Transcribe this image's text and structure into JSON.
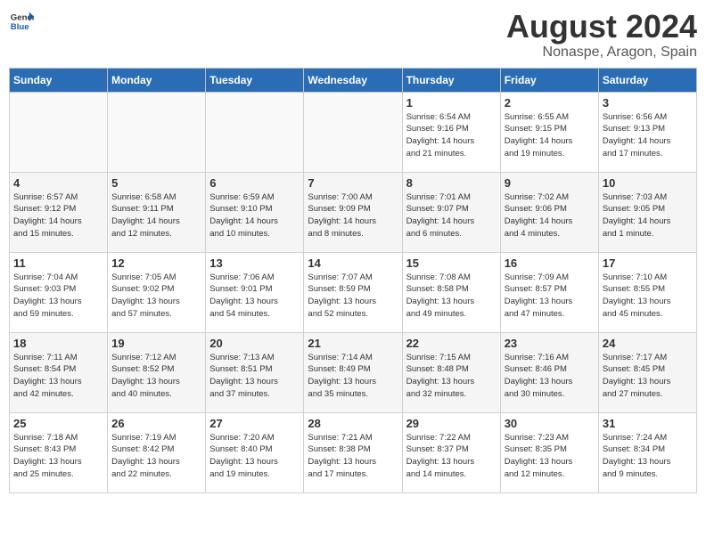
{
  "logo": {
    "general": "General",
    "blue": "Blue"
  },
  "title": {
    "month_year": "August 2024",
    "location": "Nonaspe, Aragon, Spain"
  },
  "weekdays": [
    "Sunday",
    "Monday",
    "Tuesday",
    "Wednesday",
    "Thursday",
    "Friday",
    "Saturday"
  ],
  "weeks": [
    [
      {
        "day": "",
        "info": ""
      },
      {
        "day": "",
        "info": ""
      },
      {
        "day": "",
        "info": ""
      },
      {
        "day": "",
        "info": ""
      },
      {
        "day": "1",
        "info": "Sunrise: 6:54 AM\nSunset: 9:16 PM\nDaylight: 14 hours\nand 21 minutes."
      },
      {
        "day": "2",
        "info": "Sunrise: 6:55 AM\nSunset: 9:15 PM\nDaylight: 14 hours\nand 19 minutes."
      },
      {
        "day": "3",
        "info": "Sunrise: 6:56 AM\nSunset: 9:13 PM\nDaylight: 14 hours\nand 17 minutes."
      }
    ],
    [
      {
        "day": "4",
        "info": "Sunrise: 6:57 AM\nSunset: 9:12 PM\nDaylight: 14 hours\nand 15 minutes."
      },
      {
        "day": "5",
        "info": "Sunrise: 6:58 AM\nSunset: 9:11 PM\nDaylight: 14 hours\nand 12 minutes."
      },
      {
        "day": "6",
        "info": "Sunrise: 6:59 AM\nSunset: 9:10 PM\nDaylight: 14 hours\nand 10 minutes."
      },
      {
        "day": "7",
        "info": "Sunrise: 7:00 AM\nSunset: 9:09 PM\nDaylight: 14 hours\nand 8 minutes."
      },
      {
        "day": "8",
        "info": "Sunrise: 7:01 AM\nSunset: 9:07 PM\nDaylight: 14 hours\nand 6 minutes."
      },
      {
        "day": "9",
        "info": "Sunrise: 7:02 AM\nSunset: 9:06 PM\nDaylight: 14 hours\nand 4 minutes."
      },
      {
        "day": "10",
        "info": "Sunrise: 7:03 AM\nSunset: 9:05 PM\nDaylight: 14 hours\nand 1 minute."
      }
    ],
    [
      {
        "day": "11",
        "info": "Sunrise: 7:04 AM\nSunset: 9:03 PM\nDaylight: 13 hours\nand 59 minutes."
      },
      {
        "day": "12",
        "info": "Sunrise: 7:05 AM\nSunset: 9:02 PM\nDaylight: 13 hours\nand 57 minutes."
      },
      {
        "day": "13",
        "info": "Sunrise: 7:06 AM\nSunset: 9:01 PM\nDaylight: 13 hours\nand 54 minutes."
      },
      {
        "day": "14",
        "info": "Sunrise: 7:07 AM\nSunset: 8:59 PM\nDaylight: 13 hours\nand 52 minutes."
      },
      {
        "day": "15",
        "info": "Sunrise: 7:08 AM\nSunset: 8:58 PM\nDaylight: 13 hours\nand 49 minutes."
      },
      {
        "day": "16",
        "info": "Sunrise: 7:09 AM\nSunset: 8:57 PM\nDaylight: 13 hours\nand 47 minutes."
      },
      {
        "day": "17",
        "info": "Sunrise: 7:10 AM\nSunset: 8:55 PM\nDaylight: 13 hours\nand 45 minutes."
      }
    ],
    [
      {
        "day": "18",
        "info": "Sunrise: 7:11 AM\nSunset: 8:54 PM\nDaylight: 13 hours\nand 42 minutes."
      },
      {
        "day": "19",
        "info": "Sunrise: 7:12 AM\nSunset: 8:52 PM\nDaylight: 13 hours\nand 40 minutes."
      },
      {
        "day": "20",
        "info": "Sunrise: 7:13 AM\nSunset: 8:51 PM\nDaylight: 13 hours\nand 37 minutes."
      },
      {
        "day": "21",
        "info": "Sunrise: 7:14 AM\nSunset: 8:49 PM\nDaylight: 13 hours\nand 35 minutes."
      },
      {
        "day": "22",
        "info": "Sunrise: 7:15 AM\nSunset: 8:48 PM\nDaylight: 13 hours\nand 32 minutes."
      },
      {
        "day": "23",
        "info": "Sunrise: 7:16 AM\nSunset: 8:46 PM\nDaylight: 13 hours\nand 30 minutes."
      },
      {
        "day": "24",
        "info": "Sunrise: 7:17 AM\nSunset: 8:45 PM\nDaylight: 13 hours\nand 27 minutes."
      }
    ],
    [
      {
        "day": "25",
        "info": "Sunrise: 7:18 AM\nSunset: 8:43 PM\nDaylight: 13 hours\nand 25 minutes."
      },
      {
        "day": "26",
        "info": "Sunrise: 7:19 AM\nSunset: 8:42 PM\nDaylight: 13 hours\nand 22 minutes."
      },
      {
        "day": "27",
        "info": "Sunrise: 7:20 AM\nSunset: 8:40 PM\nDaylight: 13 hours\nand 19 minutes."
      },
      {
        "day": "28",
        "info": "Sunrise: 7:21 AM\nSunset: 8:38 PM\nDaylight: 13 hours\nand 17 minutes."
      },
      {
        "day": "29",
        "info": "Sunrise: 7:22 AM\nSunset: 8:37 PM\nDaylight: 13 hours\nand 14 minutes."
      },
      {
        "day": "30",
        "info": "Sunrise: 7:23 AM\nSunset: 8:35 PM\nDaylight: 13 hours\nand 12 minutes."
      },
      {
        "day": "31",
        "info": "Sunrise: 7:24 AM\nSunset: 8:34 PM\nDaylight: 13 hours\nand 9 minutes."
      }
    ]
  ]
}
